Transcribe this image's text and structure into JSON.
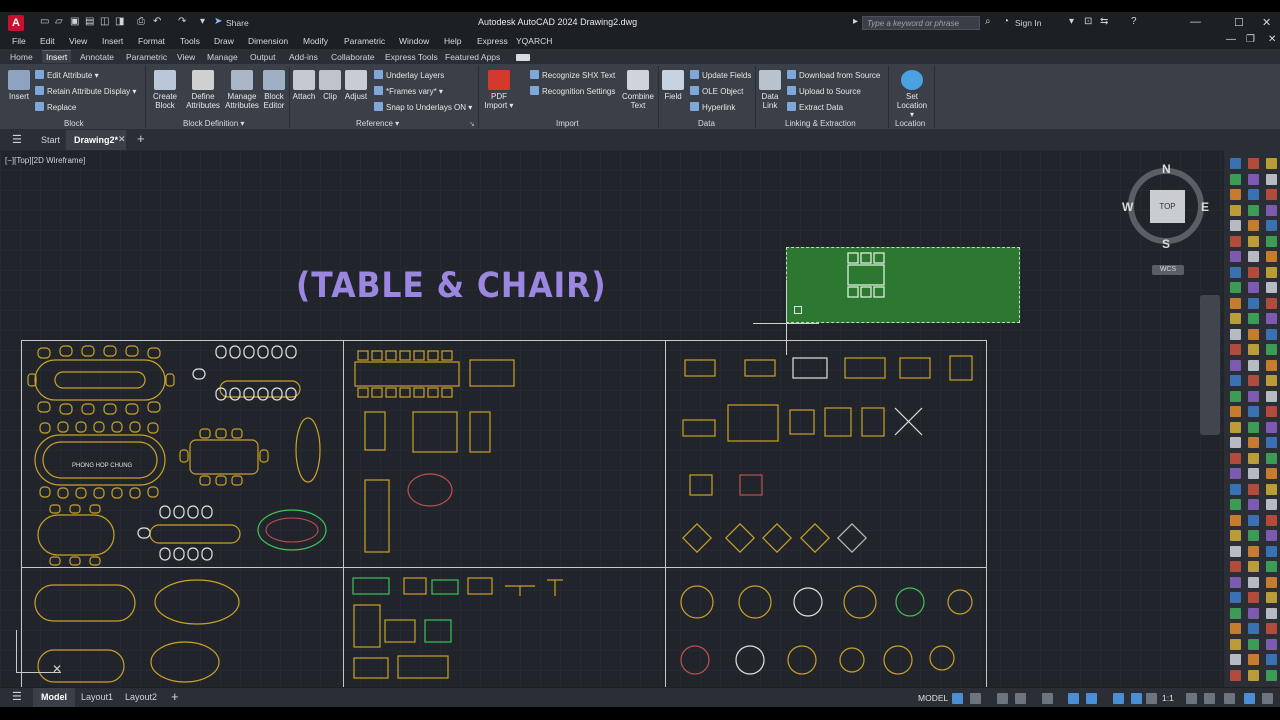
{
  "app": {
    "title": "Autodesk AutoCAD 2024   Drawing2.dwg",
    "logo": "A",
    "share_label": "Share",
    "search_placeholder": "Type a keyword or phrase",
    "sign_in": "Sign In"
  },
  "menu": [
    "File",
    "Edit",
    "View",
    "Insert",
    "Format",
    "Tools",
    "Draw",
    "Dimension",
    "Modify",
    "Parametric",
    "Window",
    "Help",
    "Express",
    "YQARCH"
  ],
  "ribbon_tabs": [
    "Home",
    "Insert",
    "Annotate",
    "Parametric",
    "View",
    "Manage",
    "Output",
    "Add-ins",
    "Collaborate",
    "Express Tools",
    "Featured Apps"
  ],
  "ribbon_active_tab": "Insert",
  "ribbon": {
    "block": {
      "title": "Block",
      "insert": "Insert",
      "edit_attribute": "Edit Attribute",
      "retain_attribute_display": "Retain Attribute Display",
      "replace": "Replace"
    },
    "block_definition": {
      "title": "Block Definition",
      "create_block": [
        "Create",
        "Block"
      ],
      "define_attributes": [
        "Define",
        "Attributes"
      ],
      "manage_attributes": [
        "Manage",
        "Attributes"
      ],
      "block_editor": [
        "Block",
        "Editor"
      ]
    },
    "reference": {
      "title": "Reference",
      "attach": "Attach",
      "clip": "Clip",
      "adjust": "Adjust",
      "underlay_layers": "Underlay Layers",
      "frames_vary": "*Frames vary*",
      "snap_to_underlays": "Snap to Underlays ON"
    },
    "import": {
      "title": "Import",
      "pdf_import": [
        "PDF",
        "Import"
      ],
      "recognize_shx": "Recognize SHX Text",
      "recognition_settings": "Recognition Settings",
      "combine_text": [
        "Combine",
        "Text"
      ]
    },
    "data": {
      "title": "Data",
      "field": "Field",
      "update_fields": "Update Fields",
      "ole_object": "OLE Object",
      "hyperlink": "Hyperlink"
    },
    "linking": {
      "title": "Linking & Extraction",
      "data_link": [
        "Data",
        "Link"
      ],
      "download_from_source": "Download from Source",
      "upload_to_source": "Upload to Source",
      "extract_data": "Extract  Data"
    },
    "location": {
      "title": "Location",
      "set_location": [
        "Set",
        "Location"
      ]
    }
  },
  "doc_tabs": {
    "start": "Start",
    "active": "Drawing2*"
  },
  "viewport_label": "[−][Top][2D Wireframe]",
  "drawing_title": "(TABLE & CHAIR)",
  "block_label": "PHONG HOP CHUNG",
  "viewcube": {
    "top": "TOP",
    "n": "N",
    "s": "S",
    "e": "E",
    "w": "W",
    "wcs": "WCS"
  },
  "status": {
    "model_tab": "Model",
    "layout1": "Layout1",
    "layout2": "Layout2",
    "model_label": "MODEL",
    "scale": "1:1"
  },
  "colors": {
    "yellow": "#c9a227",
    "white": "#e0e0e0",
    "green": "#3cc35a",
    "red": "#c05050",
    "title": "#9b86e0",
    "selection": "#2e7d32"
  }
}
